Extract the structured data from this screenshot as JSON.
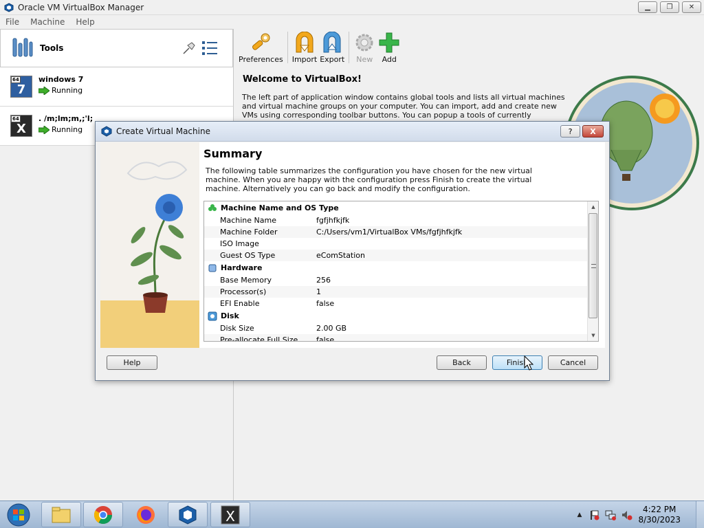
{
  "window": {
    "title": "Oracle VM VirtualBox Manager"
  },
  "menu": {
    "items": [
      "File",
      "Machine",
      "Help"
    ]
  },
  "tools": {
    "label": "Tools"
  },
  "vms": [
    {
      "name": "windows 7",
      "status": "Running",
      "badge": "64",
      "glyph": "7"
    },
    {
      "name": ". /m;lm;m,;'l;",
      "status": "Running",
      "badge": "64",
      "glyph": "X"
    }
  ],
  "toolbar": {
    "preferences": "Preferences",
    "import": "Import",
    "export": "Export",
    "new": "New",
    "add": "Add"
  },
  "welcome": {
    "title": "Welcome to VirtualBox!",
    "text": "The left part of application window contains global tools and lists all virtual machines and virtual machine groups on your computer. You can import, add and create new VMs using corresponding toolbar buttons. You can popup a tools of currently selected element using"
  },
  "dialog": {
    "title": "Create Virtual Machine",
    "help_glyph": "?",
    "close_glyph": "X",
    "summary_title": "Summary",
    "summary_desc": "The following table summarizes the configuration you have chosen for the new virtual machine. When you are happy with the configuration press Finish to create the virtual machine. Alternatively you can go back and modify the configuration.",
    "sections": {
      "name_os": {
        "title": "Machine Name and OS Type",
        "rows": [
          {
            "key": "Machine Name",
            "value": "fgfjhfkjfk"
          },
          {
            "key": "Machine Folder",
            "value": "C:/Users/vm1/VirtualBox VMs/fgfjhfkjfk"
          },
          {
            "key": "ISO Image",
            "value": ""
          },
          {
            "key": "Guest OS Type",
            "value": "eComStation"
          }
        ]
      },
      "hardware": {
        "title": "Hardware",
        "rows": [
          {
            "key": "Base Memory",
            "value": "256"
          },
          {
            "key": "Processor(s)",
            "value": "1"
          },
          {
            "key": "EFI Enable",
            "value": "false"
          }
        ]
      },
      "disk": {
        "title": "Disk",
        "rows": [
          {
            "key": "Disk Size",
            "value": "2.00 GB"
          },
          {
            "key": "Pre-allocate Full Size",
            "value": "false"
          }
        ]
      }
    },
    "buttons": {
      "help": "Help",
      "back": "Back",
      "finish": "Finish",
      "cancel": "Cancel"
    }
  },
  "taskbar": {
    "apps": [
      "windows-explorer",
      "chrome",
      "firefox",
      "virtualbox",
      "vm-window"
    ],
    "clock_time": "4:22 PM",
    "clock_date": "8/30/2023",
    "tray_arrow": "▲"
  },
  "colors": {
    "accent": "#3c7fb1",
    "running": "#3fae2a",
    "add": "#39b54a",
    "import_export": "#f2a81d"
  }
}
